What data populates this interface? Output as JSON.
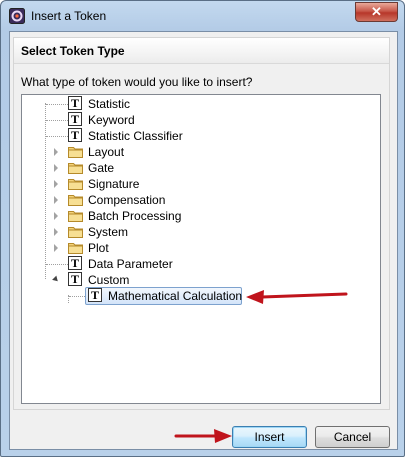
{
  "window": {
    "title": "Insert a Token",
    "close_glyph": "✕"
  },
  "group": {
    "title": "Select Token Type",
    "question": "What type of token would you like to insert?"
  },
  "tree": {
    "items": [
      {
        "label": "Statistic",
        "icon": "token-icon",
        "type": "leaf"
      },
      {
        "label": "Keyword",
        "icon": "token-icon",
        "type": "leaf"
      },
      {
        "label": "Statistic Classifier",
        "icon": "token-icon",
        "type": "leaf"
      },
      {
        "label": "Layout",
        "icon": "folder-icon",
        "type": "collapsed"
      },
      {
        "label": "Gate",
        "icon": "folder-icon",
        "type": "collapsed"
      },
      {
        "label": "Signature",
        "icon": "folder-icon",
        "type": "collapsed"
      },
      {
        "label": "Compensation",
        "icon": "folder-icon",
        "type": "collapsed"
      },
      {
        "label": "Batch Processing",
        "icon": "folder-icon",
        "type": "collapsed"
      },
      {
        "label": "System",
        "icon": "folder-icon",
        "type": "collapsed"
      },
      {
        "label": "Plot",
        "icon": "folder-icon",
        "type": "collapsed"
      },
      {
        "label": "Data Parameter",
        "icon": "token-icon",
        "type": "leaf"
      },
      {
        "label": "Custom",
        "icon": "token-icon",
        "type": "expanded"
      },
      {
        "label": "Mathematical Calculation",
        "icon": "token-icon",
        "type": "child-selected"
      }
    ],
    "token_glyph": "T"
  },
  "buttons": {
    "insert": "Insert",
    "cancel": "Cancel"
  },
  "colors": {
    "annotation_arrow": "#c0141c",
    "folder": "#e8c158",
    "selection": "#d3e4f9"
  }
}
